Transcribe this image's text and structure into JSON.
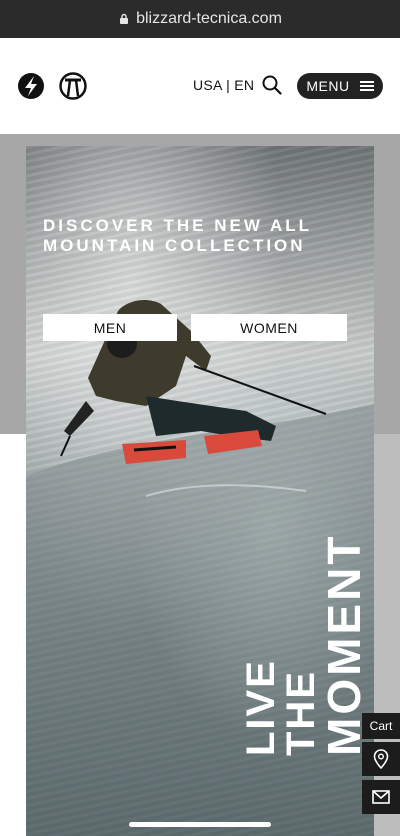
{
  "browser": {
    "url": "blizzard-tecnica.com"
  },
  "header": {
    "locale": "USA | EN",
    "menu_label": "MENU",
    "logo_left_icon": "blizzard-logo-icon",
    "logo_right_icon": "tecnica-logo-icon"
  },
  "hero": {
    "headline": "DISCOVER THE NEW ALL MOUNTAIN COLLECTION",
    "buttons": {
      "men": "MEN",
      "women": "WOMEN"
    },
    "vertical_lines": [
      "LIVE",
      "THE",
      "MOMENT"
    ]
  },
  "actions": {
    "cart": "Cart",
    "location_icon": "location-pin-icon",
    "mail_icon": "mail-icon"
  },
  "colors": {
    "dark": "#222222",
    "gray_band": "#a7a7a7",
    "white": "#ffffff"
  }
}
